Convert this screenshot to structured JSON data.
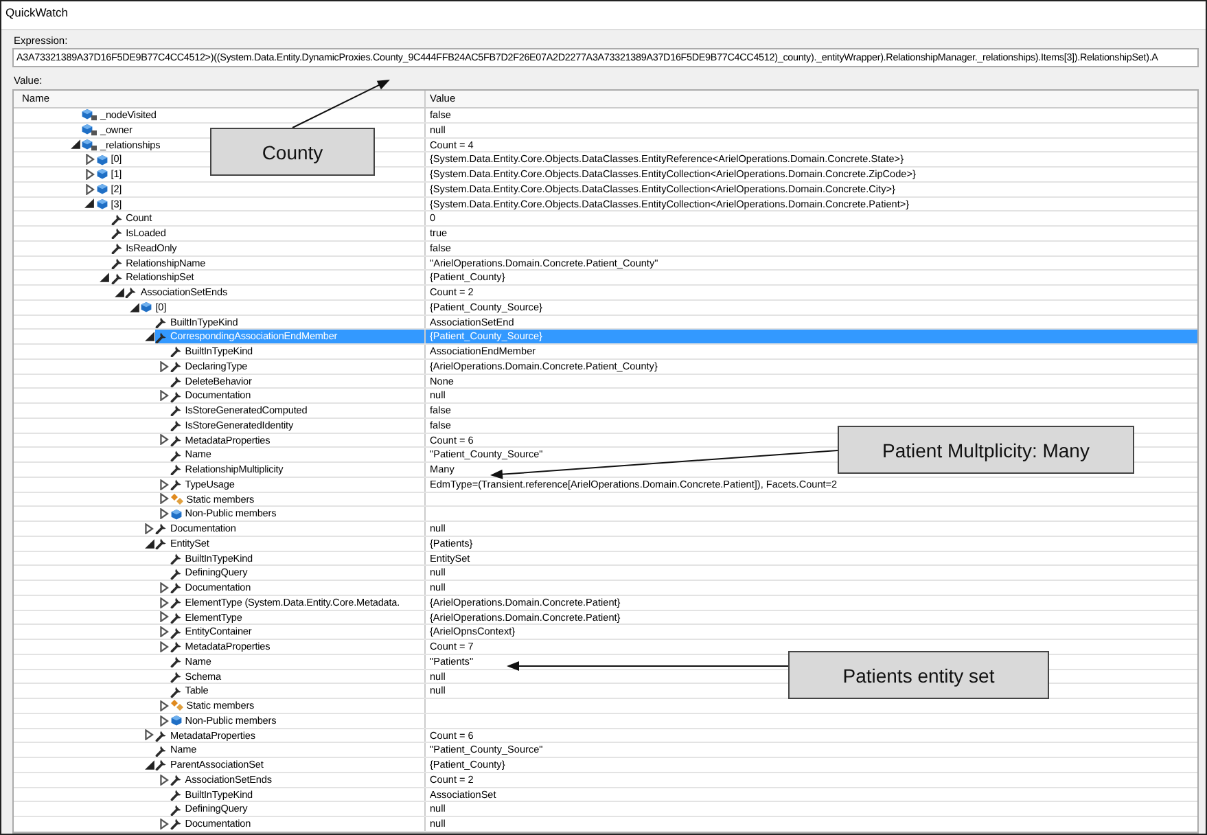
{
  "window": {
    "title": "QuickWatch"
  },
  "expression": {
    "label": "Expression:",
    "value": "A3A73321389A37D16F5DE9B77C4CC4512>)((System.Data.Entity.DynamicProxies.County_9C444FFB24AC5FB7D2F26E07A2D2277A3A73321389A37D16F5DE9B77C4CC4512)_county)._entityWrapper).RelationshipManager._relationships).Items[3]).RelationshipSet).A"
  },
  "value_label": "Value:",
  "table": {
    "columns": [
      "Name",
      "Value"
    ],
    "rows": [
      {
        "name": "_nodeVisited",
        "value": "false",
        "kind": "private-field",
        "expandable": false,
        "selected": false
      },
      {
        "name": "_owner",
        "value": "null",
        "kind": "private-field",
        "expandable": false,
        "selected": false
      },
      {
        "name": "_relationships",
        "value": "Count = 4",
        "kind": "private-field",
        "expandable": true,
        "expanded": true,
        "selected": false,
        "children": [
          {
            "name": "[0]",
            "value": "{System.Data.Entity.Core.Objects.DataClasses.EntityReference<ArielOperations.Domain.Concrete.State>}",
            "kind": "object",
            "expandable": true,
            "expanded": false,
            "selected": false
          },
          {
            "name": "[1]",
            "value": "{System.Data.Entity.Core.Objects.DataClasses.EntityCollection<ArielOperations.Domain.Concrete.ZipCode>}",
            "kind": "object",
            "expandable": true,
            "expanded": false,
            "selected": false
          },
          {
            "name": "[2]",
            "value": "{System.Data.Entity.Core.Objects.DataClasses.EntityCollection<ArielOperations.Domain.Concrete.City>}",
            "kind": "object",
            "expandable": true,
            "expanded": false,
            "selected": false
          },
          {
            "name": "[3]",
            "value": "{System.Data.Entity.Core.Objects.DataClasses.EntityCollection<ArielOperations.Domain.Concrete.Patient>}",
            "kind": "object",
            "expandable": true,
            "expanded": true,
            "selected": false,
            "children": [
              {
                "name": "Count",
                "value": "0",
                "kind": "property",
                "expandable": false,
                "selected": false
              },
              {
                "name": "IsLoaded",
                "value": "true",
                "kind": "property",
                "expandable": false,
                "selected": false
              },
              {
                "name": "IsReadOnly",
                "value": "false",
                "kind": "property",
                "expandable": false,
                "selected": false
              },
              {
                "name": "RelationshipName",
                "value": "\"ArielOperations.Domain.Concrete.Patient_County\"",
                "kind": "property",
                "expandable": false,
                "selected": false
              },
              {
                "name": "RelationshipSet",
                "value": "{Patient_County}",
                "kind": "property",
                "expandable": true,
                "expanded": true,
                "selected": false,
                "children": [
                  {
                    "name": "AssociationSetEnds",
                    "value": "Count = 2",
                    "kind": "property",
                    "expandable": true,
                    "expanded": true,
                    "selected": false,
                    "children": [
                      {
                        "name": "[0]",
                        "value": "{Patient_County_Source}",
                        "kind": "object",
                        "expandable": true,
                        "expanded": true,
                        "selected": false,
                        "children": [
                          {
                            "name": "BuiltInTypeKind",
                            "value": "AssociationSetEnd",
                            "kind": "property",
                            "expandable": false,
                            "selected": false
                          },
                          {
                            "name": "CorrespondingAssociationEndMember",
                            "value": "{Patient_County_Source}",
                            "kind": "property",
                            "expandable": true,
                            "expanded": true,
                            "selected": true,
                            "children": [
                              {
                                "name": "BuiltInTypeKind",
                                "value": "AssociationEndMember",
                                "kind": "property",
                                "expandable": false,
                                "selected": false
                              },
                              {
                                "name": "DeclaringType",
                                "value": "{ArielOperations.Domain.Concrete.Patient_County}",
                                "kind": "property",
                                "expandable": true,
                                "expanded": false,
                                "selected": false
                              },
                              {
                                "name": "DeleteBehavior",
                                "value": "None",
                                "kind": "property",
                                "expandable": false,
                                "selected": false
                              },
                              {
                                "name": "Documentation",
                                "value": "null",
                                "kind": "property",
                                "expandable": true,
                                "expanded": false,
                                "selected": false
                              },
                              {
                                "name": "IsStoreGeneratedComputed",
                                "value": "false",
                                "kind": "property",
                                "expandable": false,
                                "selected": false
                              },
                              {
                                "name": "IsStoreGeneratedIdentity",
                                "value": "false",
                                "kind": "property",
                                "expandable": false,
                                "selected": false
                              },
                              {
                                "name": "MetadataProperties",
                                "value": "Count = 6",
                                "kind": "property",
                                "expandable": true,
                                "expanded": false,
                                "selected": false
                              },
                              {
                                "name": "Name",
                                "value": "\"Patient_County_Source\"",
                                "kind": "property",
                                "expandable": false,
                                "selected": false
                              },
                              {
                                "name": "RelationshipMultiplicity",
                                "value": "Many",
                                "kind": "property",
                                "expandable": false,
                                "selected": false
                              },
                              {
                                "name": "TypeUsage",
                                "value": "EdmType=(Transient.reference[ArielOperations.Domain.Concrete.Patient]), Facets.Count=2",
                                "kind": "property",
                                "expandable": true,
                                "expanded": false,
                                "selected": false
                              },
                              {
                                "name": "Static members",
                                "kind": "static",
                                "expandable": true,
                                "expanded": false,
                                "selected": false
                              },
                              {
                                "name": "Non-Public members",
                                "kind": "object",
                                "expandable": true,
                                "expanded": false,
                                "selected": false
                              }
                            ]
                          },
                          {
                            "name": "Documentation",
                            "value": "null",
                            "kind": "property",
                            "expandable": true,
                            "expanded": false,
                            "selected": false
                          },
                          {
                            "name": "EntitySet",
                            "value": "{Patients}",
                            "kind": "property",
                            "expandable": true,
                            "expanded": true,
                            "selected": false,
                            "children": [
                              {
                                "name": "BuiltInTypeKind",
                                "value": "EntitySet",
                                "kind": "property",
                                "expandable": false,
                                "selected": false
                              },
                              {
                                "name": "DefiningQuery",
                                "value": "null",
                                "kind": "property",
                                "expandable": false,
                                "selected": false
                              },
                              {
                                "name": "Documentation",
                                "value": "null",
                                "kind": "property",
                                "expandable": true,
                                "expanded": false,
                                "selected": false
                              },
                              {
                                "name": "ElementType (System.Data.Entity.Core.Metadata.",
                                "value": "{ArielOperations.Domain.Concrete.Patient}",
                                "kind": "property",
                                "expandable": true,
                                "expanded": false,
                                "selected": false
                              },
                              {
                                "name": "ElementType",
                                "value": "{ArielOperations.Domain.Concrete.Patient}",
                                "kind": "property",
                                "expandable": true,
                                "expanded": false,
                                "selected": false
                              },
                              {
                                "name": "EntityContainer",
                                "value": "{ArielOpnsContext}",
                                "kind": "property",
                                "expandable": true,
                                "expanded": false,
                                "selected": false
                              },
                              {
                                "name": "MetadataProperties",
                                "value": "Count = 7",
                                "kind": "property",
                                "expandable": true,
                                "expanded": false,
                                "selected": false
                              },
                              {
                                "name": "Name",
                                "value": "\"Patients\"",
                                "kind": "property",
                                "expandable": false,
                                "selected": false
                              },
                              {
                                "name": "Schema",
                                "value": "null",
                                "kind": "property",
                                "expandable": false,
                                "selected": false
                              },
                              {
                                "name": "Table",
                                "value": "null",
                                "kind": "property",
                                "expandable": false,
                                "selected": false
                              },
                              {
                                "name": "Static members",
                                "kind": "static",
                                "expandable": true,
                                "expanded": false,
                                "selected": false
                              },
                              {
                                "name": "Non-Public members",
                                "kind": "object",
                                "expandable": true,
                                "expanded": false,
                                "selected": false
                              }
                            ]
                          },
                          {
                            "name": "MetadataProperties",
                            "value": "Count = 6",
                            "kind": "property",
                            "expandable": true,
                            "expanded": false,
                            "selected": false
                          },
                          {
                            "name": "Name",
                            "value": "\"Patient_County_Source\"",
                            "kind": "property",
                            "expandable": false,
                            "selected": false
                          },
                          {
                            "name": "ParentAssociationSet",
                            "value": "{Patient_County}",
                            "kind": "property",
                            "expandable": true,
                            "expanded": true,
                            "selected": false,
                            "children": [
                              {
                                "name": "AssociationSetEnds",
                                "value": "Count = 2",
                                "kind": "property",
                                "expandable": true,
                                "expanded": false,
                                "selected": false
                              },
                              {
                                "name": "BuiltInTypeKind",
                                "value": "AssociationSet",
                                "kind": "property",
                                "expandable": false,
                                "selected": false
                              },
                              {
                                "name": "DefiningQuery",
                                "value": "null",
                                "kind": "property",
                                "expandable": false,
                                "selected": false
                              },
                              {
                                "name": "Documentation",
                                "value": "null",
                                "kind": "property",
                                "expandable": true,
                                "expanded": false,
                                "selected": false
                              }
                            ]
                          }
                        ]
                      }
                    ]
                  }
                ]
              }
            ]
          }
        ]
      }
    ]
  },
  "annotations": [
    {
      "text": "County"
    },
    {
      "text": "Patient Multplicity: Many"
    },
    {
      "text": "Patients entity set"
    }
  ]
}
